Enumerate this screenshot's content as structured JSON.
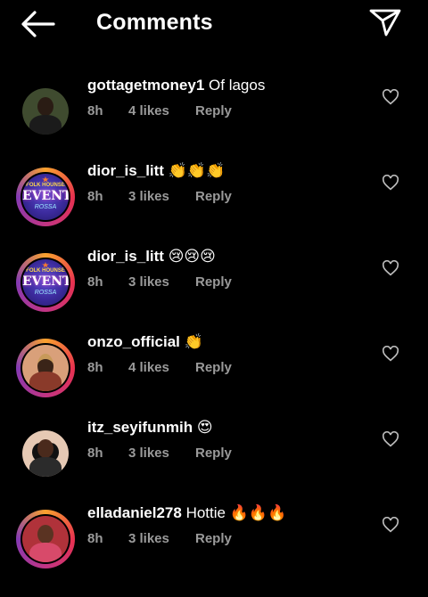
{
  "header": {
    "title": "Comments"
  },
  "comments": [
    {
      "username": "gottagetmoney1",
      "text": "Of lagos",
      "emoji": "",
      "time": "8h",
      "likes": "4 likes",
      "reply": "Reply",
      "avatar": "photo-person-green"
    },
    {
      "username": "dior_is_litt",
      "text": "",
      "emoji": "👏👏👏",
      "time": "8h",
      "likes": "3 likes",
      "reply": "Reply",
      "avatar": "event-logo"
    },
    {
      "username": "dior_is_litt",
      "text": "",
      "emoji": "😢😢😢",
      "time": "8h",
      "likes": "3 likes",
      "reply": "Reply",
      "avatar": "event-logo"
    },
    {
      "username": "onzo_official",
      "text": "",
      "emoji": "👏",
      "time": "8h",
      "likes": "4 likes",
      "reply": "Reply",
      "avatar": "photo-person-hat"
    },
    {
      "username": "itz_seyifunmih",
      "text": "",
      "emoji": "😍",
      "time": "8h",
      "likes": "3 likes",
      "reply": "Reply",
      "avatar": "photo-person-braids"
    },
    {
      "username": "elladaniel278",
      "text": "Hottie",
      "emoji": "🔥🔥🔥",
      "time": "8h",
      "likes": "3 likes",
      "reply": "Reply",
      "avatar": "photo-person-red"
    }
  ],
  "event_logo": {
    "top": "FOLK HOUNSE",
    "main": "EVENT",
    "sub": "ROSSA"
  },
  "colors": {
    "background": "#000000",
    "meta": "#9a9a9a",
    "ring": "#e8314f"
  },
  "icons": {
    "back": "back-arrow-icon",
    "send": "send-icon",
    "like": "heart-icon"
  }
}
